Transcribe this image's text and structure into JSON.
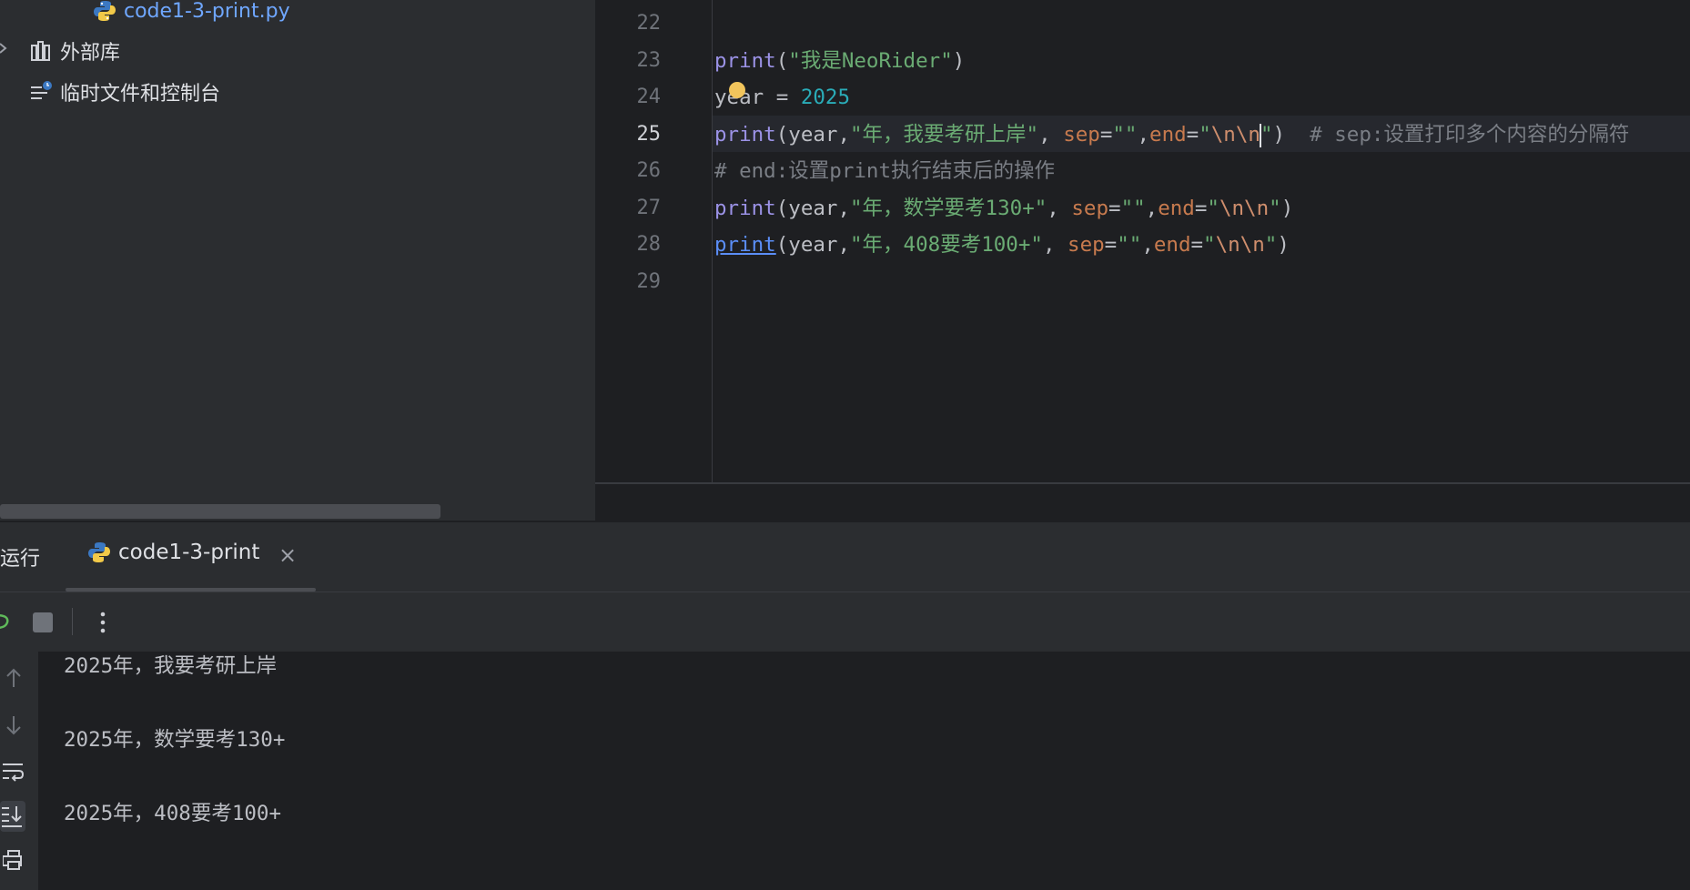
{
  "project_tree": {
    "items": [
      {
        "label": "code1-3-print.py",
        "icon": "python-file-icon"
      },
      {
        "label": "外部库",
        "icon": "library-icon"
      },
      {
        "label": "临时文件和控制台",
        "icon": "scratch-console-icon"
      }
    ]
  },
  "editor": {
    "line_numbers": [
      "22",
      "23",
      "24",
      "25",
      "26",
      "27",
      "28",
      "29"
    ],
    "current_line": "25",
    "lines": {
      "l23": {
        "fn": "print",
        "p1": "(",
        "s1": "\"我是NeoRider\"",
        "p2": ")"
      },
      "l24": {
        "var": "year = ",
        "num": "2025"
      },
      "l25": {
        "fn": "print",
        "a": "(year,",
        "s1": "\"年，我要考研上岸\"",
        "b": ", ",
        "k1": "sep",
        "c": "=",
        "s2": "\"\"",
        "d": ",",
        "k2": "end",
        "e": "=",
        "s3": "\"",
        "esc": "\\n\\n",
        "s4": "\"",
        "f": ")  ",
        "cmt": "# sep:设置打印多个内容的分隔符"
      },
      "l26": {
        "cmt": "# end:设置print执行结束后的操作"
      },
      "l27": {
        "fn": "print",
        "a": "(year,",
        "s1": "\"年，数学要考130+\"",
        "b": ", ",
        "k1": "sep",
        "c": "=",
        "s2": "\"\"",
        "d": ",",
        "k2": "end",
        "e": "=",
        "s3": "\"",
        "esc": "\\n\\n",
        "s4": "\"",
        "f": ")"
      },
      "l28": {
        "fn": "print",
        "a": "(year,",
        "s1": "\"年，408要考100+\"",
        "b": ", ",
        "k1": "sep",
        "c": "=",
        "s2": "\"\"",
        "d": ",",
        "k2": "end",
        "e": "=",
        "s3": "\"",
        "esc": "\\n\\n",
        "s4": "\"",
        "f": ")"
      }
    }
  },
  "run_panel": {
    "title": "运行",
    "tab_label": "code1-3-print",
    "close_glyph": "×",
    "output": [
      "2025年，我要考研上岸",
      "2025年，数学要考130+",
      "2025年，408要考100+"
    ]
  },
  "colors": {
    "background": "#1e1f22",
    "panel": "#2b2d30",
    "function": "#9b92e6",
    "string": "#6aab73",
    "number": "#2aacb8",
    "keyword_arg": "#c77a4e",
    "comment": "#7a7e85"
  }
}
